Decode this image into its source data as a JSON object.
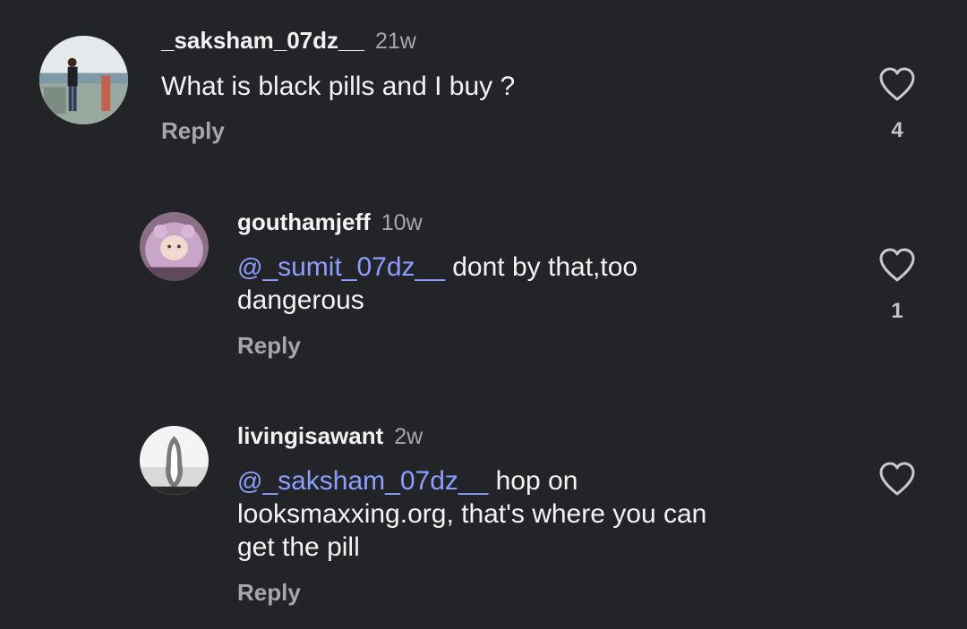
{
  "comments": [
    {
      "username": "_saksham_07dz__",
      "time": "21w",
      "text": "What is black pills and I buy ?",
      "reply_label": "Reply",
      "likes": "4",
      "avatar_icon": "avatar-photo-man-standing"
    },
    {
      "username": "gouthamjeff",
      "time": "10w",
      "mention_icon": "@",
      "mention": "_sumit_07dz__",
      "text_line1": " dont by that,too",
      "text_line2": "dangerous",
      "reply_label": "Reply",
      "likes": "1",
      "avatar_icon": "avatar-photo-baby"
    },
    {
      "username": "livingisawant",
      "time": "2w",
      "mention_icon": "@",
      "mention": "_saksham_07dz__",
      "text_line1": " hop on",
      "text_line2": "looksmaxxing.org, that's where you can",
      "text_line3": "get the pill",
      "reply_label": "Reply",
      "avatar_icon": "avatar-photo-light"
    }
  ],
  "colors": {
    "background": "#232428",
    "mention": "#8c9eff",
    "muted": "#a5a7ad"
  }
}
